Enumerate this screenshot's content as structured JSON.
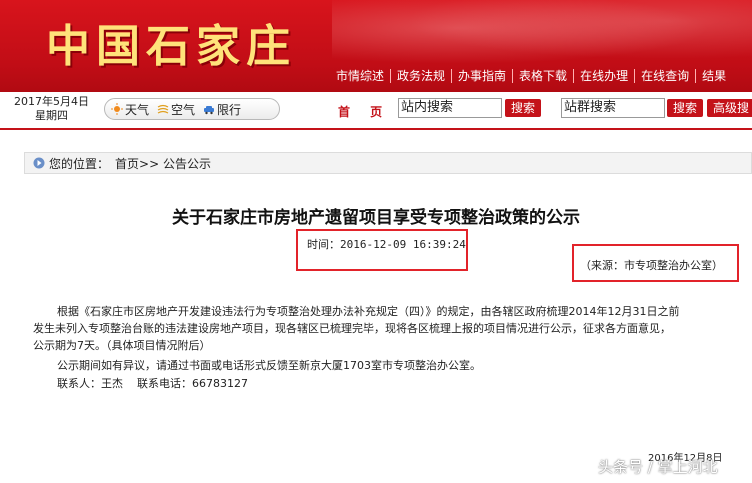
{
  "header": {
    "logo": "中国石家庄",
    "nav": [
      "市情综述",
      "政务法规",
      "办事指南",
      "表格下载",
      "在线办理",
      "在线查询",
      "结果"
    ]
  },
  "infobar": {
    "date_line1": "2017年5月4日",
    "date_line2": "星期四",
    "pills": [
      {
        "icon": "sun-icon",
        "label": "天气"
      },
      {
        "icon": "air-icon",
        "label": "空气"
      },
      {
        "icon": "car-icon",
        "label": "限行"
      }
    ],
    "home": "首 页",
    "site_search_value": "站内搜索",
    "search_button": "搜索",
    "group_search_value": "站群搜索",
    "search_button2": "搜索",
    "advanced_search": "高级搜"
  },
  "breadcrumb": {
    "prefix": "您的位置：",
    "path": "首页>> 公告公示"
  },
  "article": {
    "title": "关于石家庄市房地产遗留项目享受专项整治政策的公示",
    "time": "时间：2016-12-09 16:39:24",
    "source": "（来源：市专项整治办公室）",
    "para1_line1": "根据《石家庄市区房地产开发建设违法行为专项整治处理办法补充规定（四）》的规定，由各辖区政府梳理2014年12月31日之前",
    "para1_line2": "发生未列入专项整治台账的违法建设房地产项目，现各辖区已梳理完毕，现将各区梳理上报的项目情况进行公示，征求各方面意见，",
    "para1_line3": "公示期为7天。（具体项目情况附后）",
    "para2": "公示期间如有异议，请通过书面或电话形式反馈至新京大厦1703室市专项整治办公室。",
    "contact": "联系人：王杰    联系电话：66783127",
    "signdate": "2016年12月8日"
  },
  "watermark": "头条号 / 掌上河北",
  "colors": {
    "brand_red": "#c41219",
    "highlight_red": "#e2232a",
    "logo_gold": "#ffe27a"
  }
}
